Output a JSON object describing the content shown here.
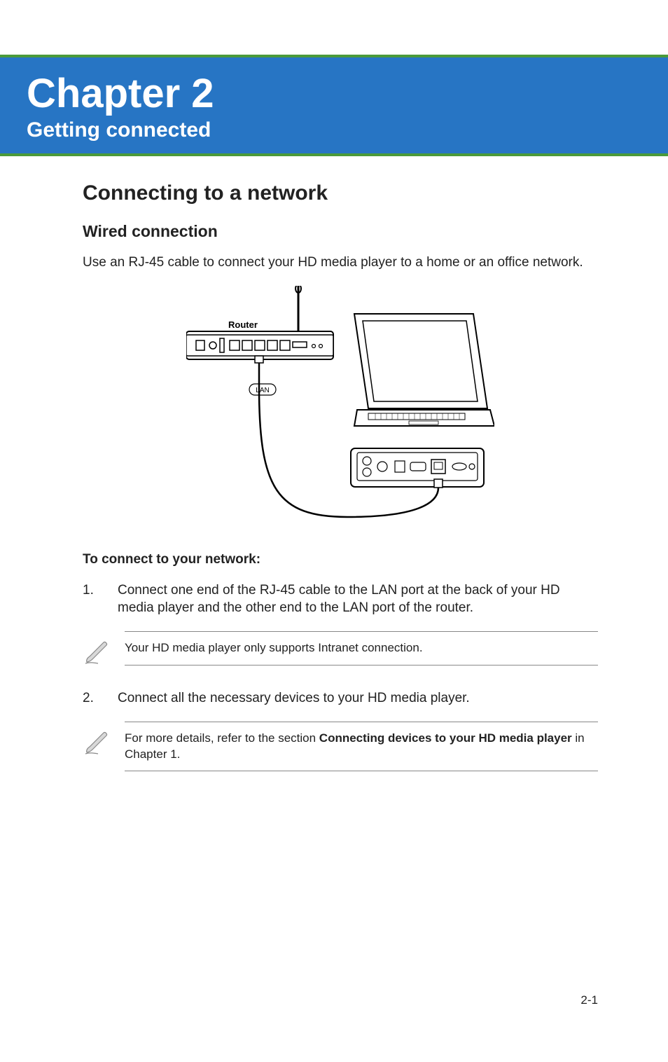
{
  "header": {
    "chapter_title": "Chapter 2",
    "chapter_subtitle": "Getting connected"
  },
  "section": {
    "title": "Connecting to a network",
    "subsection_title": "Wired connection",
    "intro": "Use an RJ-45 cable to connect your HD media player to a home or an office network."
  },
  "diagram": {
    "router_label": "Router",
    "lan_label": "LAN"
  },
  "procedure": {
    "title": "To connect to your network:",
    "steps": [
      {
        "num": "1.",
        "text": "Connect one end of the RJ-45 cable to the LAN port at the back of your HD media player and the other end to the LAN port of the router."
      },
      {
        "num": "2.",
        "text": "Connect all the necessary devices to your HD media player."
      }
    ]
  },
  "notes": [
    {
      "text": "Your HD media player only supports Intranet connection."
    },
    {
      "prefix": "For more details, refer to the section ",
      "bold": "Connecting devices to your HD media player",
      "suffix": " in Chapter 1."
    }
  ],
  "page_number": "2-1"
}
